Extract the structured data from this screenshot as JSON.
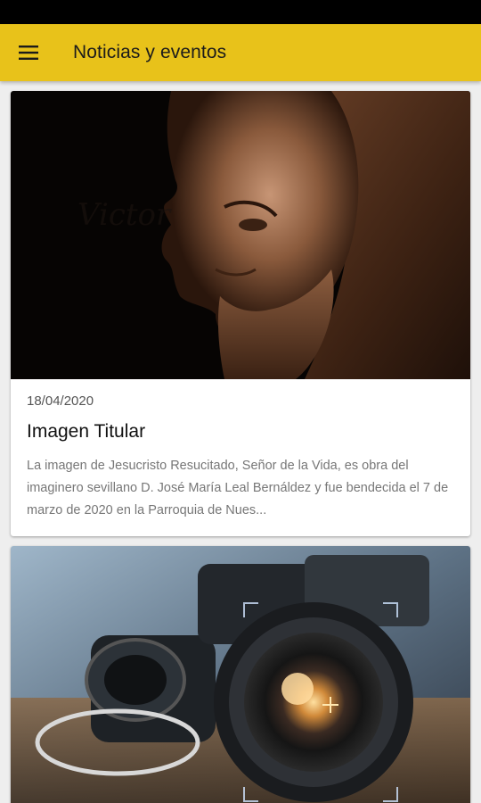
{
  "app_bar": {
    "title": "Noticias y eventos",
    "menu_icon": "menu-icon",
    "color": "#e8c21a"
  },
  "news": [
    {
      "date": "18/04/2020",
      "title": "Imagen Titular",
      "excerpt": "La imagen de Jesucristo Resucitado, Señor de la Vida, es obra del imaginero sevillano D. José María Leal Bernáldez y fue bendecida el 7 de marzo de 2020 en la Parroquia de Nues...",
      "image": "sculpture-photo"
    },
    {
      "image": "camera-lens-photo"
    }
  ]
}
